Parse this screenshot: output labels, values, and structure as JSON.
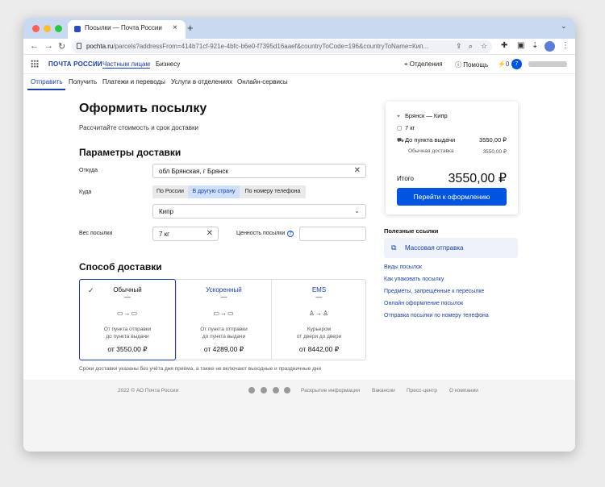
{
  "browser": {
    "tab_title": "Посылки — Почта России",
    "tab_close": "×",
    "new_tab": "+",
    "url_host": "pochta.ru",
    "url_path": "/parcels?addressFrom=414b71cf-921e-4bfc-b6e0-f7395d16aaef&countryToCode=196&countryToName=Кип...",
    "icons": {
      "back": "←",
      "forward": "→",
      "reload": "↻"
    }
  },
  "header": {
    "logo": "ПОЧТА РОССИИ",
    "links": [
      "Частным лицам",
      "Бизнесу"
    ],
    "offices": "Отделения",
    "help": "Помощь",
    "bonus_count": "0",
    "user_initial": "7"
  },
  "subnav": [
    "Отправить",
    "Получить",
    "Платежи и переводы",
    "Услуги в отделениях",
    "Онлайн-сервисы"
  ],
  "main": {
    "title": "Оформить посылку",
    "subtitle": "Рассчитайте стоимость и срок доставки",
    "params_title": "Параметры доставки",
    "from_label": "Откуда",
    "from_value": "обл Брянская, г Брянск",
    "to_label": "Куда",
    "to_tabs": [
      "По России",
      "В другую страну",
      "По номеру телефона"
    ],
    "country_value": "Кипр",
    "weight_label": "Вес посылки",
    "weight_value": "7 кг",
    "value_label": "Ценность посылки",
    "delivery_title": "Способ доставки",
    "options": [
      {
        "title": "Обычный",
        "dash": "—",
        "desc1": "От пункта отправки",
        "desc2": "до пункта выдачи",
        "price": "от 3550,00 ₽"
      },
      {
        "title": "Ускоренный",
        "dash": "—",
        "desc1": "От пункта отправки",
        "desc2": "до пункта выдачи",
        "price": "от 4289,00 ₽"
      },
      {
        "title": "EMS",
        "dash": "—",
        "desc1": "Курьером",
        "desc2": "от двери до двери",
        "price": "от 8442,00 ₽"
      }
    ],
    "note": "Сроки доставки указаны без учёта дня приёма, а также не включают выходные и праздничные дни"
  },
  "summary": {
    "route": "Брянск — Кипр",
    "weight": "7 кг",
    "pickup_label": "До пункта выдачи",
    "pickup_price": "3550,00 ₽",
    "type_label": "Обычная доставка",
    "type_price": "3550,00 ₽",
    "total_label": "Итого",
    "total_value": "3550,00 ₽",
    "button": "Перейти к оформлению"
  },
  "useful": {
    "title": "Полезные ссылки",
    "mass": "Массовая отправка",
    "links": [
      "Виды посылок",
      "Как упаковать посылку",
      "Предметы, запрещённые к пересылке",
      "Онлайн оформление посылок",
      "Отправка посылки по номеру телефона"
    ]
  },
  "footer": {
    "copyright": "2022 © АО Почта России",
    "links": [
      "Раскрытие информации",
      "Вакансии",
      "Пресс-центр",
      "О компании"
    ]
  },
  "colors": {
    "accent": "#0055e0",
    "brand": "#1a3fa8"
  }
}
